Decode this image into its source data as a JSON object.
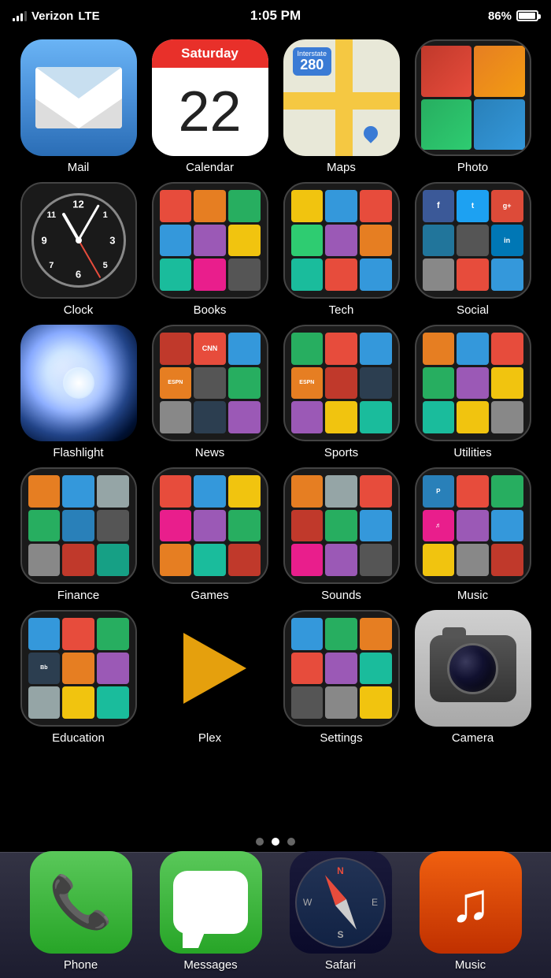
{
  "statusBar": {
    "carrier": "Verizon",
    "network": "LTE",
    "time": "1:05 PM",
    "battery": "86%"
  },
  "apps": [
    {
      "id": "mail",
      "label": "Mail"
    },
    {
      "id": "calendar",
      "label": "Calendar"
    },
    {
      "id": "maps",
      "label": "Maps"
    },
    {
      "id": "photo",
      "label": "Photo"
    },
    {
      "id": "clock",
      "label": "Clock"
    },
    {
      "id": "books",
      "label": "Books"
    },
    {
      "id": "tech",
      "label": "Tech"
    },
    {
      "id": "social",
      "label": "Social"
    },
    {
      "id": "flashlight",
      "label": "Flashlight"
    },
    {
      "id": "news",
      "label": "News"
    },
    {
      "id": "sports",
      "label": "Sports"
    },
    {
      "id": "utilities",
      "label": "Utilities"
    },
    {
      "id": "finance",
      "label": "Finance"
    },
    {
      "id": "games",
      "label": "Games"
    },
    {
      "id": "sounds",
      "label": "Sounds"
    },
    {
      "id": "music",
      "label": "Music"
    },
    {
      "id": "education",
      "label": "Education"
    },
    {
      "id": "plex",
      "label": "Plex"
    },
    {
      "id": "settings",
      "label": "Settings"
    },
    {
      "id": "camera",
      "label": "Camera"
    }
  ],
  "calendar": {
    "month": "Saturday",
    "day": "22"
  },
  "maps": {
    "highway": "280"
  },
  "dock": [
    {
      "id": "phone",
      "label": "Phone"
    },
    {
      "id": "messages",
      "label": "Messages"
    },
    {
      "id": "safari",
      "label": "Safari"
    },
    {
      "id": "music-dock",
      "label": "Music"
    }
  ]
}
